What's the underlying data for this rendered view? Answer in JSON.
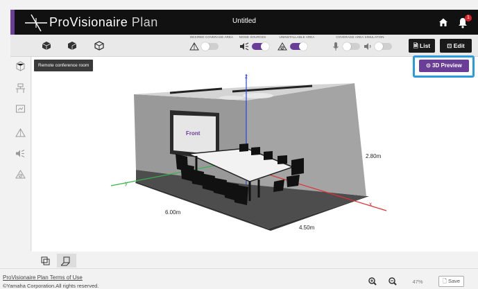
{
  "app": {
    "brand_main": "ProVisionaire",
    "brand_sub": "Plan",
    "document_title": "Untitled",
    "notification_count": "1",
    "accent_color": "#6a3e97"
  },
  "toolbar": {
    "groups": [
      {
        "caption": "DESIRED COVERAGE AREA",
        "icon": "coverage-icon",
        "state": "off"
      },
      {
        "caption": "NOISE SOURCES",
        "icon": "noise-icon",
        "state": "on"
      },
      {
        "caption": "UNINSTALLABLE AREA",
        "icon": "uninstallable-icon",
        "state": "on"
      },
      {
        "caption": "COVERAGE AREA SIMULATION",
        "icon": "mic-icon",
        "state": "off"
      },
      {
        "caption": "",
        "icon": "speaker-icon",
        "state": "off"
      }
    ],
    "list_label": "List",
    "edit_label": "Edit"
  },
  "canvas": {
    "room_name": "Remote conference room",
    "preview_label": "3D Preview",
    "screen_label": "Front",
    "dim_width": "6.00m",
    "dim_depth": "4.50m",
    "dim_height": "2.80m",
    "axis_z": "z",
    "axis_y": "y",
    "axis_x": "x"
  },
  "footer": {
    "terms": "ProVisionaire Plan Terms of Use",
    "copyright": "©Yamaha Corporation.All rights reserved.",
    "zoom": "47%",
    "save_label": "Save"
  }
}
